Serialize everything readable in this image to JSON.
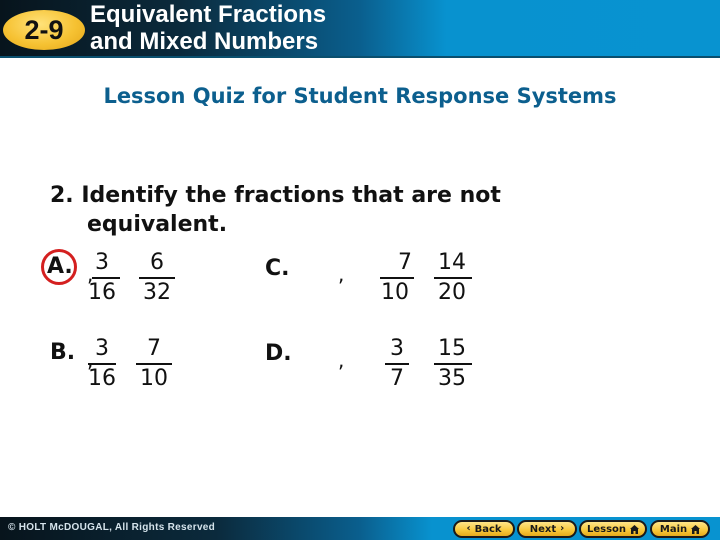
{
  "header": {
    "lesson_number": "2-9",
    "title_line1": "Equivalent Fractions",
    "title_line2": "and Mixed Numbers"
  },
  "subtitle": "Lesson Quiz for Student Response Systems",
  "question": {
    "line1": "2. Identify the fractions that are not",
    "line2": "equivalent."
  },
  "choices": [
    {
      "label": "A.",
      "selected": true,
      "separator": ",",
      "fractions": [
        {
          "numerator": "3",
          "denominator": "16"
        },
        {
          "numerator": "6",
          "denominator": "32"
        }
      ]
    },
    {
      "label": "B.",
      "selected": false,
      "separator": ",",
      "fractions": [
        {
          "numerator": "3",
          "denominator": "16"
        },
        {
          "numerator": "7",
          "denominator": "10"
        }
      ]
    },
    {
      "label": "C.",
      "selected": false,
      "separator": ",",
      "fractions": [
        {
          "numerator": "7",
          "denominator": "10"
        },
        {
          "numerator": "14",
          "denominator": "20"
        }
      ]
    },
    {
      "label": "D.",
      "selected": false,
      "separator": ",",
      "fractions": [
        {
          "numerator": "3",
          "denominator": "7"
        },
        {
          "numerator": "15",
          "denominator": "35"
        }
      ]
    }
  ],
  "footer": {
    "copyright": "© HOLT McDOUGAL, All Rights Reserved",
    "buttons": {
      "back": {
        "label": "Back",
        "icon": "chevron-left-icon",
        "glyph": "‹"
      },
      "next": {
        "label": "Next",
        "icon": "chevron-right-icon",
        "glyph": "›"
      },
      "lesson": {
        "label": "Lesson",
        "icon": "home-icon"
      },
      "main": {
        "label": "Main",
        "icon": "home-icon"
      }
    }
  },
  "colors": {
    "header_accent": "#0893d0",
    "badge_yellow": "#f6c233",
    "subtitle_blue": "#0c5f8e",
    "selection_circle": "#d42020",
    "nav_button_yellow": "#f7c83a"
  }
}
